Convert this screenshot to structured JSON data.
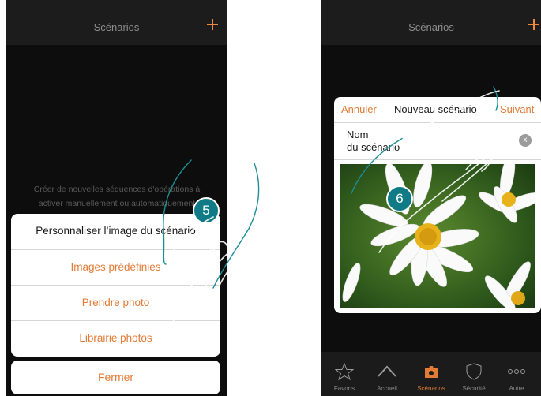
{
  "left_screen": {
    "title": "Scénarios",
    "description_line1": "Créer de nouvelles séquences d'opérations à",
    "description_line2": "activer manuellement ou automatiquement",
    "step_number": "5",
    "sheet": {
      "header": "Personnaliser l’image du scénario",
      "options": [
        "Images prédéfinies",
        "Prendre photo",
        "Librairie photos"
      ]
    },
    "close_label": "Fermer"
  },
  "right_screen": {
    "title": "Scénarios",
    "step_number": "6",
    "dialog": {
      "cancel_label": "Annuler",
      "title": "Nouveau scénario",
      "next_label": "Suivant",
      "name_label_line1": "Nom",
      "name_label_line2": "du scénario",
      "clear_glyph": "x"
    },
    "tabs": [
      {
        "label": "Favoris",
        "icon": "star-icon"
      },
      {
        "label": "Accueil",
        "icon": "home-icon"
      },
      {
        "label": "Scénarios",
        "icon": "scenarios-icon",
        "active": true
      },
      {
        "label": "Sécurité",
        "icon": "shield-icon"
      },
      {
        "label": "Autre",
        "icon": "more-icon"
      }
    ]
  },
  "colors": {
    "accent": "#e27b36",
    "badge": "#0f7b86",
    "background": "#0d0d0d"
  }
}
